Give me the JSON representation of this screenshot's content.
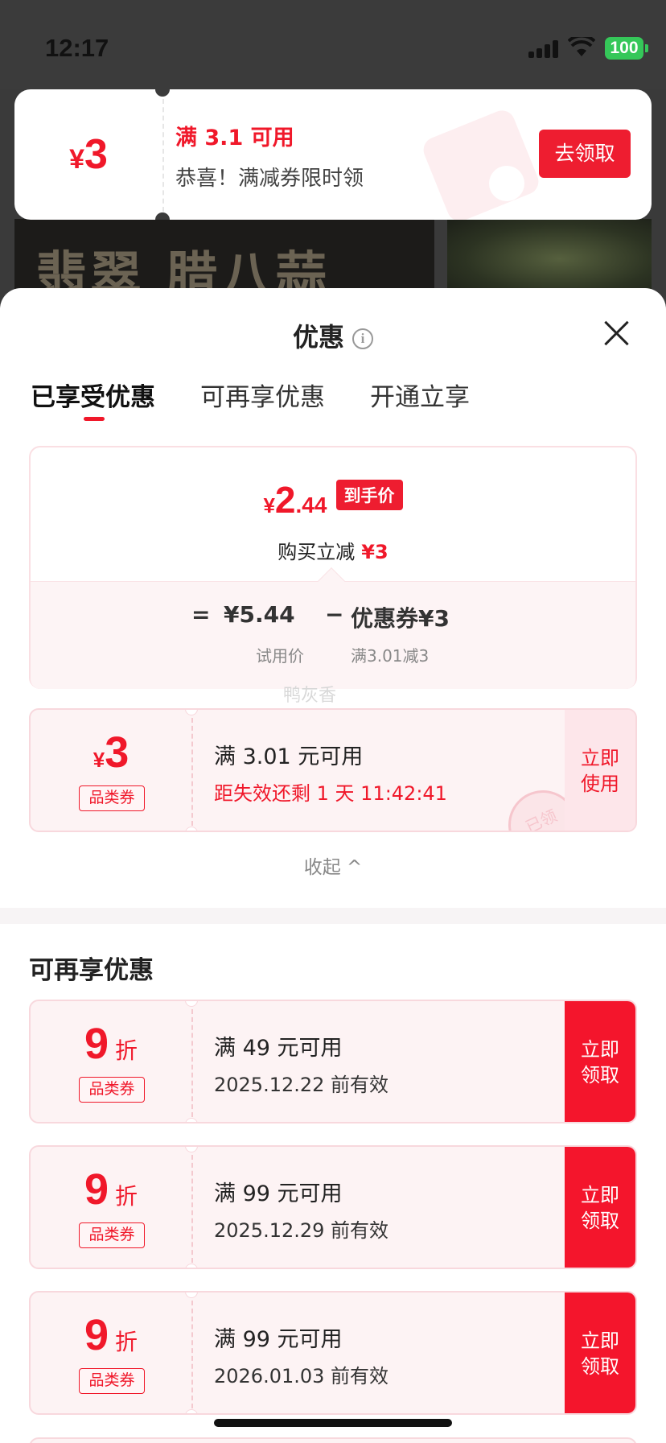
{
  "status_bar": {
    "time": "12:17",
    "battery": "100"
  },
  "background": {
    "banner_title": "翡翠 腊八蒜"
  },
  "toast": {
    "currency": "¥",
    "amount": "3",
    "condition": "满 3.1 可用",
    "description": "恭喜！满减券限时领",
    "button": "去领取"
  },
  "sheet": {
    "title": "优惠",
    "tabs": [
      "已享受优惠",
      "可再享优惠",
      "开通立享"
    ],
    "price_card": {
      "currency": "¥",
      "price_int": "2",
      "price_dec": ".44",
      "price_tag": "到手价",
      "reduce_label": "购买立减",
      "reduce_value": "¥3",
      "equals": "=",
      "trial_price": "¥5.44",
      "minus": "−",
      "coupon_label": "优惠券¥3",
      "trial_label": "试用价",
      "coupon_rule": "满3.01减3"
    },
    "watermark": "鸭灰香",
    "enjoyed_coupon": {
      "currency": "¥",
      "value": "3",
      "tag": "品类券",
      "condition": "满 3.01 元可用",
      "countdown": "距失效还剩 1 天 11:42:41",
      "action": "立即使用",
      "stamp": "已领"
    },
    "collapse_label": "收起 ^",
    "more_section_title": "可再享优惠",
    "more_coupons": [
      {
        "value": "9",
        "unit": "折",
        "tag": "品类券",
        "condition": "满 49 元可用",
        "validity": "2025.12.22 前有效",
        "action": "立即领取"
      },
      {
        "value": "9",
        "unit": "折",
        "tag": "品类券",
        "condition": "满 99 元可用",
        "validity": "2025.12.29 前有效",
        "action": "立即领取"
      },
      {
        "value": "9",
        "unit": "折",
        "tag": "品类券",
        "condition": "满 99 元可用",
        "validity": "2026.01.03 前有效",
        "action": "立即领取"
      }
    ]
  },
  "colors": {
    "accent": "#f0182a",
    "button": "#ee1d30",
    "coupon_bg": "#fdf3f4"
  }
}
